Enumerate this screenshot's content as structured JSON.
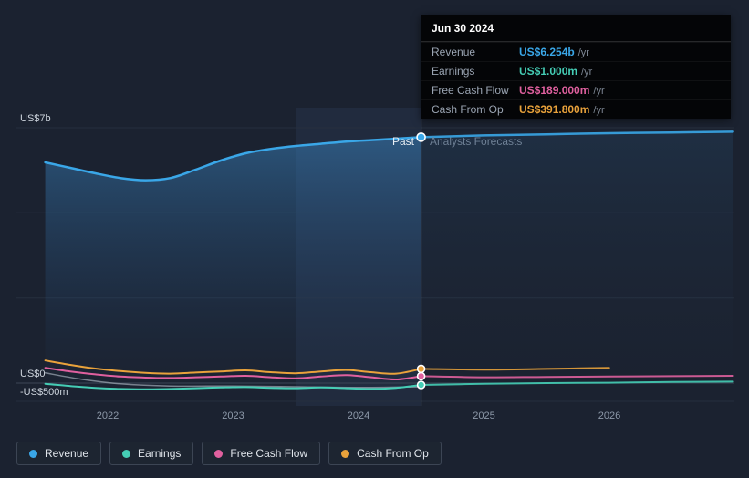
{
  "tooltip": {
    "date": "Jun 30 2024",
    "rows": [
      {
        "label": "Revenue",
        "value": "US$6.254b",
        "suffix": "/yr",
        "color": "#3aa7e8"
      },
      {
        "label": "Earnings",
        "value": "US$1.000m",
        "suffix": "/yr",
        "color": "#45cdb5"
      },
      {
        "label": "Free Cash Flow",
        "value": "US$189.000m",
        "suffix": "/yr",
        "color": "#e0609f"
      },
      {
        "label": "Cash From Op",
        "value": "US$391.800m",
        "suffix": "/yr",
        "color": "#e9a23b"
      }
    ]
  },
  "forecast_divider": {
    "past": "Past",
    "forecast": "Analysts Forecasts"
  },
  "legend": [
    {
      "label": "Revenue",
      "color": "#3aa7e8"
    },
    {
      "label": "Earnings",
      "color": "#45cdb5"
    },
    {
      "label": "Free Cash Flow",
      "color": "#e0609f"
    },
    {
      "label": "Cash From Op",
      "color": "#e9a23b"
    }
  ],
  "chart_data": {
    "type": "line",
    "units": "US$ billions per year",
    "x_range": [
      2021.27,
      2027.0
    ],
    "y_range_b": [
      -0.625,
      7.55
    ],
    "divider_x": 2024.5,
    "highlight_band": [
      2023.5,
      2024.5
    ],
    "gridline_values": [
      7,
      4.667,
      2.333,
      0,
      -0.5
    ],
    "y_ticks": [
      {
        "label": "US$7b",
        "value": 7
      },
      {
        "label": "US$0",
        "value": 0
      },
      {
        "label": "-US$500m",
        "value": -0.5
      }
    ],
    "x_ticks": [
      {
        "label": "2022",
        "x": 2022
      },
      {
        "label": "2023",
        "x": 2023
      },
      {
        "label": "2024",
        "x": 2024
      },
      {
        "label": "2025",
        "x": 2025
      },
      {
        "label": "2026",
        "x": 2026
      }
    ],
    "legend_position": "bottom",
    "series": [
      {
        "name": "Revenue",
        "color": "#3aa7e8",
        "width": 2.5,
        "fill": true,
        "marker": true,
        "past": [
          [
            2021.5,
            6.05
          ],
          [
            2021.7,
            5.9
          ],
          [
            2021.9,
            5.75
          ],
          [
            2022.1,
            5.62
          ],
          [
            2022.3,
            5.56
          ],
          [
            2022.5,
            5.62
          ],
          [
            2022.7,
            5.85
          ],
          [
            2022.9,
            6.1
          ],
          [
            2023.1,
            6.3
          ],
          [
            2023.3,
            6.42
          ],
          [
            2023.5,
            6.5
          ],
          [
            2023.7,
            6.56
          ],
          [
            2023.9,
            6.62
          ],
          [
            2024.1,
            6.66
          ],
          [
            2024.3,
            6.7
          ],
          [
            2024.5,
            6.74
          ]
        ],
        "forecast": [
          [
            2024.5,
            6.74
          ],
          [
            2025,
            6.79
          ],
          [
            2025.5,
            6.82
          ],
          [
            2026,
            6.85
          ],
          [
            2026.5,
            6.87
          ],
          [
            2026.99,
            6.89
          ]
        ]
      },
      {
        "name": "Cash From Op",
        "color": "#e9a23b",
        "width": 2,
        "fill": false,
        "marker": true,
        "past": [
          [
            2021.5,
            0.62
          ],
          [
            2021.7,
            0.5
          ],
          [
            2021.9,
            0.4
          ],
          [
            2022.1,
            0.33
          ],
          [
            2022.3,
            0.28
          ],
          [
            2022.5,
            0.26
          ],
          [
            2022.7,
            0.29
          ],
          [
            2022.9,
            0.32
          ],
          [
            2023.1,
            0.35
          ],
          [
            2023.3,
            0.3
          ],
          [
            2023.5,
            0.27
          ],
          [
            2023.7,
            0.32
          ],
          [
            2023.9,
            0.36
          ],
          [
            2024.1,
            0.3
          ],
          [
            2024.3,
            0.26
          ],
          [
            2024.5,
            0.39
          ]
        ],
        "forecast": [
          [
            2024.5,
            0.39
          ],
          [
            2025,
            0.37
          ],
          [
            2025.5,
            0.39
          ],
          [
            2026,
            0.42
          ]
        ]
      },
      {
        "name": "Free Cash Flow",
        "color": "#e0609f",
        "width": 2,
        "fill": false,
        "marker": true,
        "past": [
          [
            2021.5,
            0.42
          ],
          [
            2021.7,
            0.32
          ],
          [
            2021.9,
            0.24
          ],
          [
            2022.1,
            0.18
          ],
          [
            2022.3,
            0.15
          ],
          [
            2022.5,
            0.14
          ],
          [
            2022.7,
            0.16
          ],
          [
            2022.9,
            0.18
          ],
          [
            2023.1,
            0.2
          ],
          [
            2023.3,
            0.16
          ],
          [
            2023.5,
            0.13
          ],
          [
            2023.7,
            0.18
          ],
          [
            2023.9,
            0.22
          ],
          [
            2024.1,
            0.16
          ],
          [
            2024.3,
            0.1
          ],
          [
            2024.5,
            0.19
          ]
        ],
        "forecast": [
          [
            2024.5,
            0.19
          ],
          [
            2025,
            0.16
          ],
          [
            2025.5,
            0.17
          ],
          [
            2026,
            0.18
          ],
          [
            2026.5,
            0.19
          ],
          [
            2026.99,
            0.2
          ]
        ]
      },
      {
        "name": "unlabeled-gray",
        "color": "rgba(197,208,219,0.55)",
        "width": 1.5,
        "fill": false,
        "marker": false,
        "past": [
          [
            2021.5,
            0.28
          ],
          [
            2021.8,
            0.1
          ],
          [
            2022.1,
            -0.02
          ],
          [
            2022.5,
            -0.08
          ],
          [
            2023,
            -0.08
          ],
          [
            2023.5,
            -0.1
          ],
          [
            2024,
            -0.12
          ],
          [
            2024.5,
            -0.1
          ]
        ],
        "forecast": []
      },
      {
        "name": "Earnings",
        "color": "#45cdb5",
        "width": 2,
        "fill": false,
        "marker": true,
        "past": [
          [
            2021.5,
            -0.02
          ],
          [
            2021.7,
            -0.08
          ],
          [
            2021.9,
            -0.13
          ],
          [
            2022.1,
            -0.16
          ],
          [
            2022.3,
            -0.17
          ],
          [
            2022.5,
            -0.16
          ],
          [
            2022.7,
            -0.14
          ],
          [
            2022.9,
            -0.12
          ],
          [
            2023.1,
            -0.11
          ],
          [
            2023.3,
            -0.13
          ],
          [
            2023.5,
            -0.14
          ],
          [
            2023.7,
            -0.12
          ],
          [
            2023.9,
            -0.14
          ],
          [
            2024.1,
            -0.16
          ],
          [
            2024.3,
            -0.13
          ],
          [
            2024.5,
            -0.05
          ]
        ],
        "forecast": [
          [
            2024.5,
            -0.05
          ],
          [
            2025,
            -0.02
          ],
          [
            2025.5,
            0.0
          ],
          [
            2026,
            0.01
          ],
          [
            2026.5,
            0.03
          ],
          [
            2026.99,
            0.04
          ]
        ]
      }
    ]
  }
}
